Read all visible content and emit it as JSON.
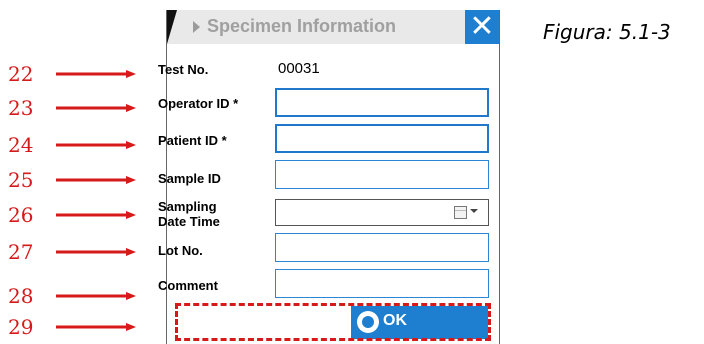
{
  "caption": "Figura: 5.1-3",
  "callouts": [
    "22",
    "23",
    "24",
    "25",
    "26",
    "27",
    "28",
    "29"
  ],
  "dialog": {
    "title": "Specimen Information",
    "close_icon": "close-icon",
    "fields": {
      "test_no_label": "Test No.",
      "test_no_value": "00031",
      "operator_label": "Operator ID *",
      "operator_value": "",
      "patient_label": "Patient ID *",
      "patient_value": "",
      "sample_label": "Sample ID",
      "sample_value": "",
      "sampling_label_1": "Sampling",
      "sampling_label_2": "Date Time",
      "sampling_value": "",
      "lot_label": "Lot No.",
      "lot_value": "",
      "comment_label": "Comment",
      "comment_value": ""
    },
    "ok_label": "OK"
  },
  "colors": {
    "accent": "#1e7fd0",
    "callout": "#d61a1a"
  }
}
